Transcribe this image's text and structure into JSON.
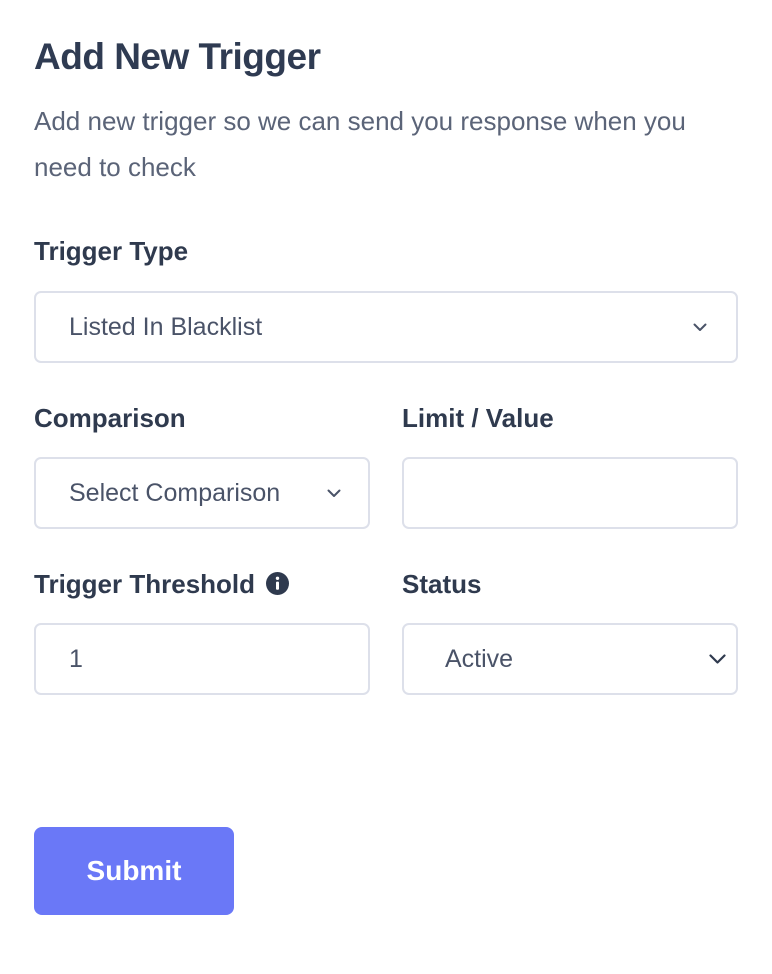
{
  "form": {
    "title": "Add New Trigger",
    "subtitle": "Add new trigger so we can send you response when you need to check",
    "fields": {
      "trigger_type": {
        "label": "Trigger Type",
        "value": "Listed In Blacklist",
        "icon": "chevron-down-icon"
      },
      "comparison": {
        "label": "Comparison",
        "placeholder": "Select Comparison",
        "icon": "chevron-down-icon"
      },
      "limit_value": {
        "label": "Limit / Value",
        "value": ""
      },
      "trigger_threshold": {
        "label": "Trigger Threshold",
        "value": "1",
        "icon": "info-icon"
      },
      "status": {
        "label": "Status",
        "value": "Active",
        "icon": "chevron-down-icon"
      }
    },
    "submit_label": "Submit"
  },
  "colors": {
    "accent": "#6a78f7",
    "title": "#2f3b52",
    "label": "#2f3a4e",
    "subtitle": "#5b6478",
    "border": "#dde0ea"
  }
}
